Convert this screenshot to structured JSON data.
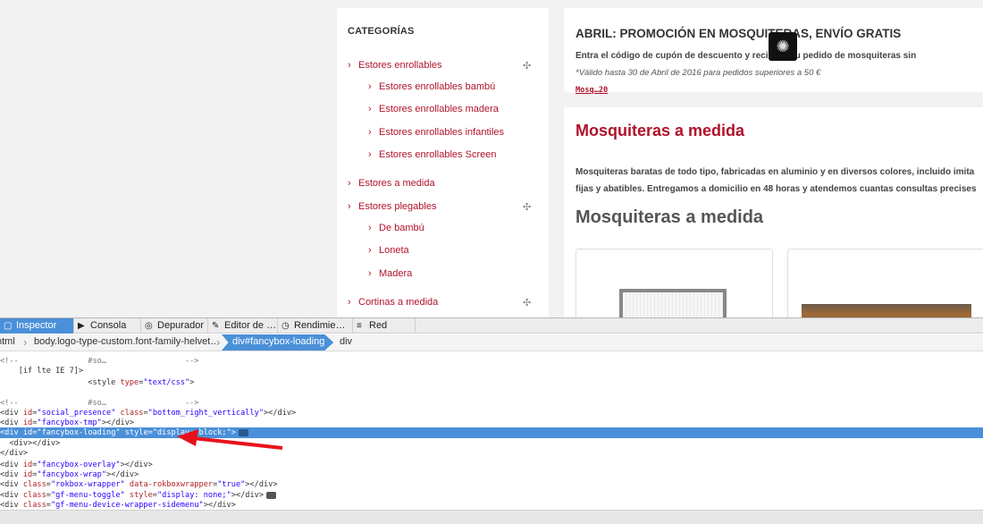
{
  "sidebar": {
    "title": "CATEGORÍAS",
    "items": [
      {
        "label": "Estores enrollables",
        "level": 0,
        "expand": true
      },
      {
        "label": "Estores enrollables bambú",
        "level": 1
      },
      {
        "label": "Estores enrollables madera",
        "level": 1
      },
      {
        "label": "Estores enrollables infantiles",
        "level": 1
      },
      {
        "label": "Estores enrollables Screen",
        "level": 1
      },
      {
        "label": "Estores a medida",
        "level": 0
      },
      {
        "label": "Estores plegables",
        "level": 0,
        "expand": true
      },
      {
        "label": "De bambú",
        "level": 1
      },
      {
        "label": "Loneta",
        "level": 1
      },
      {
        "label": "Madera",
        "level": 1
      },
      {
        "label": "Cortinas a medida",
        "level": 0,
        "expand": true
      }
    ],
    "expand_glyph": "✣",
    "chevron": "›"
  },
  "promo": {
    "title": "ABRIL: PROMOCIÓN EN MOSQUITERAS, ENVÍO GRATIS",
    "line1_a": "Entra el código de cupón de descuento ",
    "line1_code": "Mosq…20",
    "line1_b": " y recibirás tu pedido de mosquiteras sin",
    "line2": "*Válido hasta 30 de Abril de 2016 para pedidos superiores a 50 €"
  },
  "content": {
    "heading": "Mosquiteras a medida",
    "para1": "Mosquiteras baratas de todo tipo, fabricadas en aluminio y en diversos colores, incluido imita",
    "para2": "fijas y abatibles. Entregamos a domicilio en 48 horas y atendemos cuantas consultas precises",
    "subheading": "Mosquiteras a medida"
  },
  "devtools": {
    "tabs": [
      {
        "label": "Inspector",
        "icon": "inspector-icon",
        "glyph": "▢",
        "active": true
      },
      {
        "label": "Consola",
        "icon": "console-icon",
        "glyph": "▶"
      },
      {
        "label": "Depurador",
        "icon": "debugger-icon",
        "glyph": "◎"
      },
      {
        "label": "Editor de …",
        "icon": "style-editor-icon",
        "glyph": "✎"
      },
      {
        "label": "Rendimie…",
        "icon": "performance-icon",
        "glyph": "◷"
      },
      {
        "label": "Red",
        "icon": "network-icon",
        "glyph": "≡"
      }
    ],
    "breadcrumbs": [
      "html",
      "body.logo-type-custom.font-family-helvet…",
      "div#fancybox-loading",
      "div"
    ],
    "breadcrumb_active": 2,
    "lines": [
      "<!--               #so…                 -->",
      "    [if lte IE 7]>",
      "                   <style type=\"text/css\">",
      "",
      "<!--               #so…                 -->",
      "<div id=\"social_presence\" class=\"bottom_right_vertically\"></div>",
      "<div id=\"fancybox-tmp\"></div>",
      "<div id=\"fancybox-loading\" style=\"display: block;\">",
      "  <div></div>",
      "</div>",
      "<div id=\"fancybox-overlay\"></div>",
      "<div id=\"fancybox-wrap\"></div>",
      "<div class=\"rokbox-wrapper\" data-rokboxwrapper=\"true\"></div>",
      "<div class=\"gf-menu-toggle\" style=\"display: none;\"></div>",
      "<div class=\"gf-menu-device-wrapper-sidemenu\"></div>"
    ],
    "selected_line": 7,
    "event_badge_lines": [
      7,
      13
    ]
  },
  "colors": {
    "brand": "#b0132b",
    "highlight": "#4a90d9",
    "annotation_arrow": "#e8121b"
  }
}
